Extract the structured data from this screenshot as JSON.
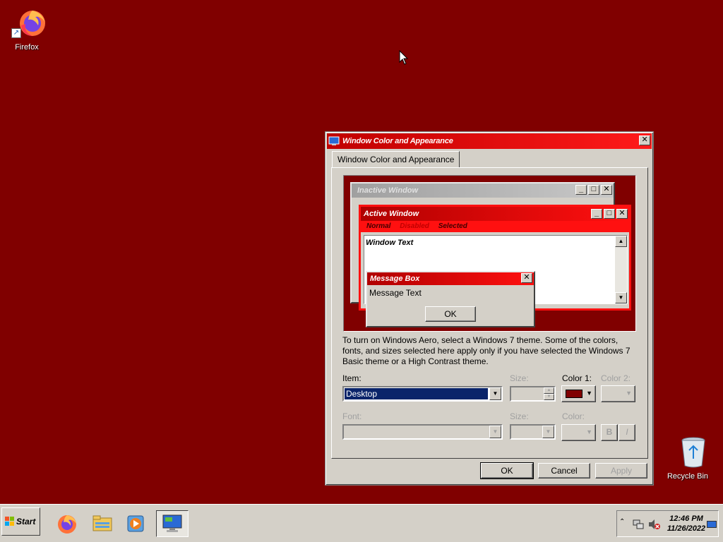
{
  "desktop": {
    "background_color": "#800000",
    "icons": [
      {
        "label": "Firefox"
      },
      {
        "label": "Recycle Bin"
      }
    ]
  },
  "dialog": {
    "title": "Window Color and Appearance",
    "tab_label": "Window Color and Appearance",
    "preview": {
      "inactive_title": "Inactive Window",
      "active_title": "Active Window",
      "menu_normal": "Normal",
      "menu_disabled": "Disabled",
      "menu_selected": "Selected",
      "window_text": "Window Text",
      "msgbox_title": "Message Box",
      "msgbox_text": "Message Text",
      "msgbox_ok": "OK"
    },
    "info_text": "To turn on Windows Aero, select a Windows 7 theme.  Some of the colors, fonts, and sizes selected here apply only if you have selected the Windows 7 Basic theme or a High Contrast theme.",
    "item_label": "Item:",
    "item_value": "Desktop",
    "size_label": "Size:",
    "color1_label": "Color 1:",
    "color1_value": "#800000",
    "color2_label": "Color 2:",
    "font_label": "Font:",
    "font_size_label": "Size:",
    "font_color_label": "Color:",
    "bold_label": "B",
    "italic_label": "I",
    "ok_label": "OK",
    "cancel_label": "Cancel",
    "apply_label": "Apply"
  },
  "taskbar": {
    "start_label": "Start",
    "clock_time": "12:46 PM",
    "clock_date": "11/26/2022"
  },
  "colors": {
    "active_title": "#ff0000",
    "inactive_title": "#a0a0a0",
    "face": "#d4d0c8",
    "selection": "#0a246a"
  }
}
